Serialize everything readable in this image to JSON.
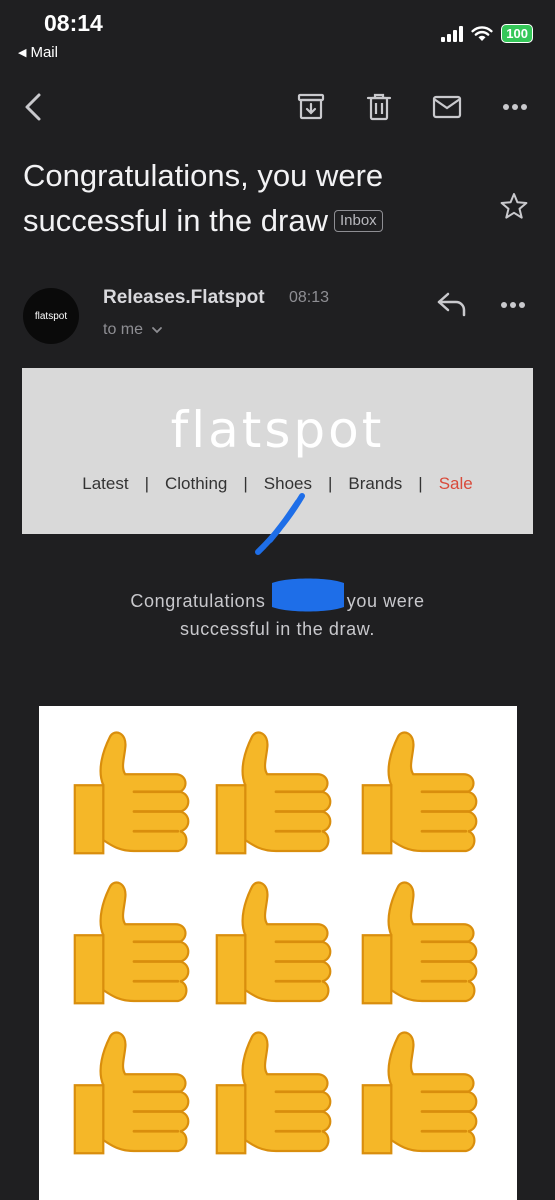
{
  "status_bar": {
    "time": "08:14",
    "back_app": "Mail",
    "battery": "100"
  },
  "email": {
    "subject": "Congratulations, you were successful in the draw",
    "folder_badge": "Inbox",
    "sender": {
      "name": "Releases.Flatspot",
      "time": "08:13",
      "recipient": "to me",
      "avatar_text": "flatspot"
    },
    "body": {
      "brand": "flatspot",
      "nav": [
        "Latest",
        "Clothing",
        "Shoes",
        "Brands",
        "Sale"
      ],
      "message_before": "Congratulations",
      "message_after": "you were",
      "message_line2": "successful in the draw.",
      "image_grid_icon": "thumbs-up-emoji",
      "image_grid_count": 9
    }
  },
  "colors": {
    "background": "#1f1f21",
    "sale": "#d94a3a",
    "battery": "#35c759",
    "redaction": "#1e6ee8",
    "thumbs": "#f5b728"
  }
}
